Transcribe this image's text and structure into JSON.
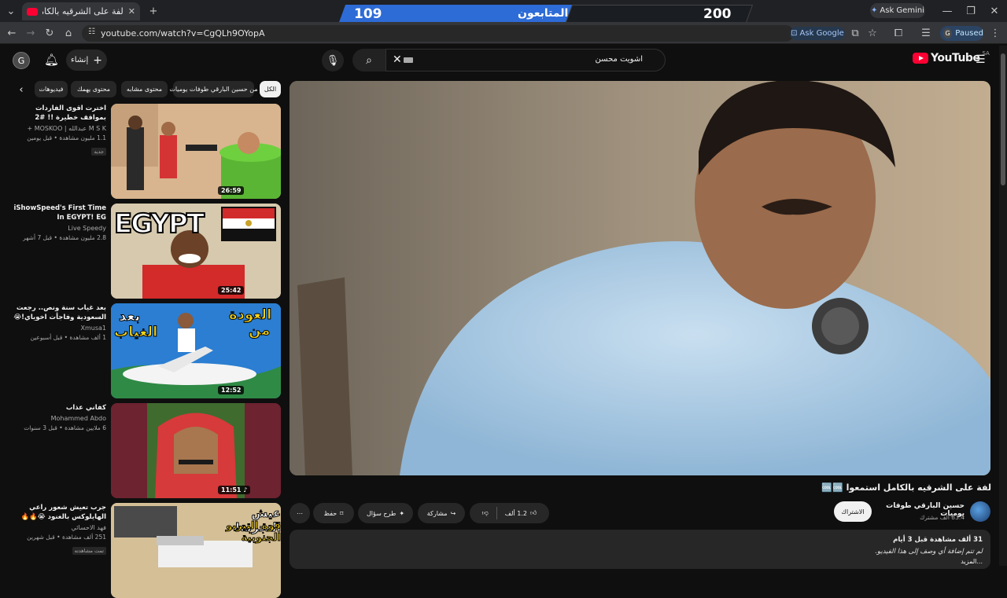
{
  "browser": {
    "tab_title": "لفة على الشرقيه  بالكامل استمعوا",
    "url": "youtube.com/watch?v=CgQLh9OYopA",
    "ask_gemini": "Ask Gemini",
    "ask_google": "Ask Google",
    "profile_initial": "G",
    "profile_status": "Paused"
  },
  "banner": {
    "current": "109",
    "label": "المتابعون",
    "goal": "200",
    "progress": 0.545
  },
  "masthead": {
    "avatar_initial": "G",
    "create_label": "إنشاء",
    "search_value": "اشويت محسن",
    "logo_text": "YouTube",
    "country_code": "SA"
  },
  "chips": [
    "الكل",
    "من حسين البارقي طوفات يوميات",
    "محتوى مشابه",
    "محتوى يهمك",
    "فيديوهات"
  ],
  "recommendations": [
    {
      "title": "اخترت اقوى الفاردات بمواقف خطيرة !! #2",
      "channel": "M S K عبدالله | MOSKOO +",
      "meta": "1.1 مليون مشاهدة • قبل يومين",
      "badge": "جديد",
      "duration": "26:59"
    },
    {
      "title": "iShowSpeed's First Time In EGYPT! EG",
      "channel": "Live Speedy",
      "meta": "2.8 مليون مشاهدة • قبل 7 أشهر",
      "badge": "",
      "duration": "25:42"
    },
    {
      "title": "بعد غياب سنة ونص.. رجعت السعودية وفاجأت اخوياي!😭",
      "channel": "Xmusa1",
      "meta": "1 ألف مشاهدة • قبل أسبوعين",
      "badge": "",
      "duration": "12:52"
    },
    {
      "title": "كفاني عذاب",
      "channel": "Mohammed Abdo",
      "meta": "6 ملايين مشاهدة • قبل 3 سنوات",
      "badge": "",
      "duration": "11:51"
    },
    {
      "title": "جرب تعيش شعور راعي الهايلوكس بالغنود 😭🔥🔥",
      "channel": "فهد الاحسائي",
      "meta": "251 ألف مشاهدة • قبل شهرين",
      "badge": "تمت مشاهدته",
      "duration": ""
    }
  ],
  "thumb_text": {
    "egypt": "EGYPT",
    "return1": "العودة",
    "return2": "من",
    "return3": "بعد",
    "return4": "الغياب",
    "exp1": "عيش التجربة!",
    "exp2": "قوة التيربو الجنوبية"
  },
  "video": {
    "title": "لفة على الشرقيه  بالكامل استمعوا 🆒🆒",
    "channel": "حسين البارقي طوفات يوميات",
    "subs": "83.4 ألف مشترك",
    "subscribe": "الاشتراك",
    "likes": "1.2 ألف",
    "share": "مشاركة",
    "ask": "طرح سؤال",
    "save": "حفظ",
    "views": "31 ألف مشاهدة  قبل 3 أيام",
    "description": "لم تتم إضافة أي وصف إلى هذا الفيديو.",
    "more": "...المزيد"
  },
  "colors": {
    "youtube_red": "#ff0033",
    "banner_blue": "#2d6bd6",
    "background": "#0f0f0f"
  }
}
